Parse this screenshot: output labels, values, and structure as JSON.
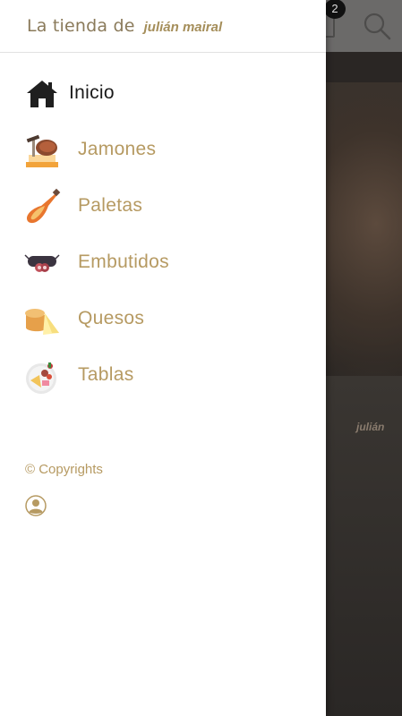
{
  "header": {
    "brand_prefix": "La tienda de",
    "brand_name": "julián mairal"
  },
  "background": {
    "cart_count": "2",
    "logo_text": "julián"
  },
  "nav": {
    "items": [
      {
        "label": "Inicio",
        "icon": "home-icon",
        "active": true
      },
      {
        "label": "Jamones",
        "icon": "ham-icon",
        "active": false
      },
      {
        "label": "Paletas",
        "icon": "paleta-icon",
        "active": false
      },
      {
        "label": "Embutidos",
        "icon": "sausage-icon",
        "active": false
      },
      {
        "label": "Quesos",
        "icon": "cheese-icon",
        "active": false
      },
      {
        "label": "Tablas",
        "icon": "platter-icon",
        "active": false
      }
    ]
  },
  "footer": {
    "copyright": "© Copyrights",
    "user_icon": "user-icon"
  },
  "colors": {
    "accent": "#b69a62",
    "active_text": "#1a1a1a",
    "drawer_bg": "#ffffff"
  }
}
